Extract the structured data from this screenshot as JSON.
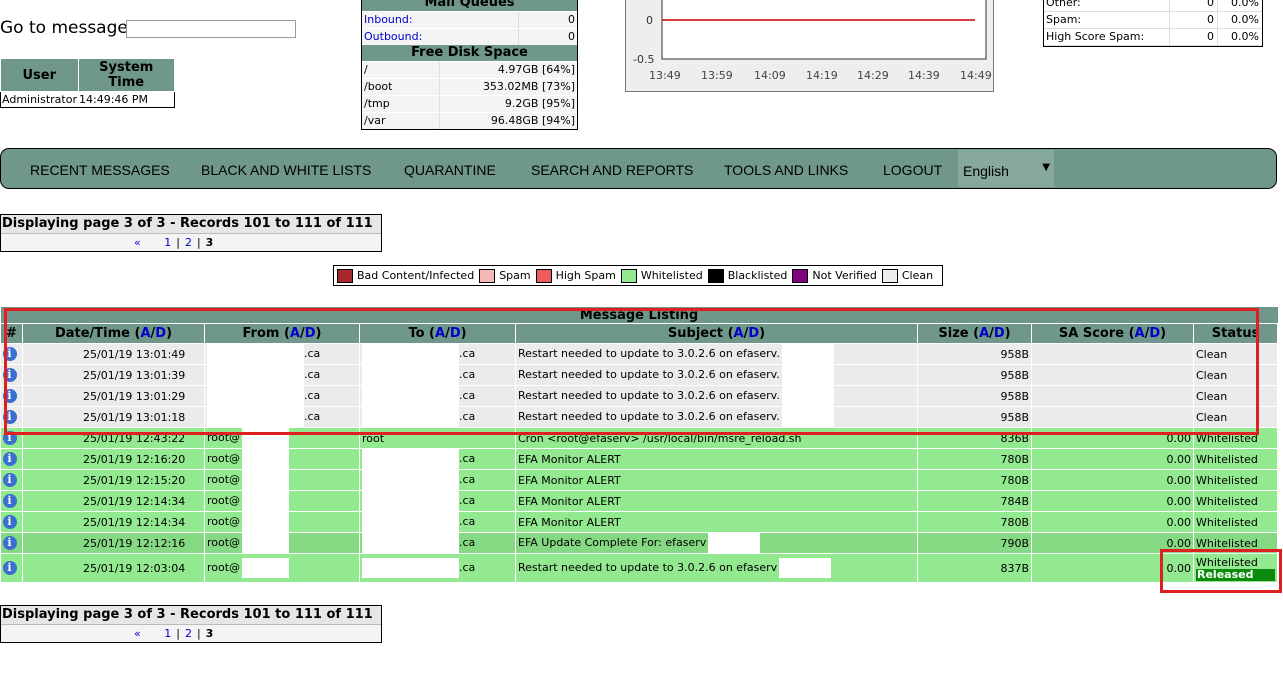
{
  "goto": {
    "label": "Go to message:",
    "placeholder": ""
  },
  "user_table": {
    "col_user": "User",
    "col_time": "System Time",
    "user": "Administrator",
    "time": "14:49:46 PM"
  },
  "queues": {
    "title": "Mail Queues",
    "inbound_label": "Inbound:",
    "inbound_value": "0",
    "outbound_label": "Outbound:",
    "outbound_value": "0"
  },
  "disk": {
    "title": "Free Disk Space",
    "rows": [
      {
        "mount": "/",
        "free": "4.97GB [64%]"
      },
      {
        "mount": "/boot",
        "free": "353.02MB [73%]"
      },
      {
        "mount": "/tmp",
        "free": "9.2GB [95%]"
      },
      {
        "mount": "/var",
        "free": "96.48GB [94%]"
      }
    ]
  },
  "graph": {
    "y_ticks": [
      "0",
      "-0.5"
    ],
    "x_ticks": [
      "13:49",
      "13:59",
      "14:09",
      "14:19",
      "14:29",
      "14:39",
      "14:49"
    ],
    "line_color": "#cc0000"
  },
  "stats": {
    "rows": [
      {
        "label": "Other:",
        "count": "0",
        "pct": "0.0%"
      },
      {
        "label": "Spam:",
        "count": "0",
        "pct": "0.0%"
      },
      {
        "label": "High Score Spam:",
        "count": "0",
        "pct": "0.0%"
      }
    ]
  },
  "nav": {
    "items": [
      "RECENT MESSAGES",
      "BLACK AND WHITE LISTS",
      "QUARANTINE",
      "SEARCH AND REPORTS",
      "TOOLS AND LINKS",
      "LOGOUT"
    ],
    "language": "English"
  },
  "pager": {
    "title": "Displaying page 3 of 3 - Records 101 to 111 of 111",
    "prev": "«",
    "page1": "1",
    "page2": "2",
    "current": "3",
    "sep": "|"
  },
  "legend": [
    {
      "label": "Bad Content/Infected",
      "color": "#a8282d"
    },
    {
      "label": "Spam",
      "color": "#f6b7b9"
    },
    {
      "label": "High Spam",
      "color": "#ee5b61"
    },
    {
      "label": "Whitelisted",
      "color": "#92e98f"
    },
    {
      "label": "Blacklisted",
      "color": "#000000"
    },
    {
      "label": "Not Verified",
      "color": "#800080"
    },
    {
      "label": "Clean",
      "color": "#eeeeee"
    }
  ],
  "table": {
    "caption": "Message Listing",
    "headers": {
      "num": "#",
      "date": "Date/Time",
      "from": "From",
      "to": "To",
      "subject": "Subject",
      "size": "Size",
      "score": "SA Score",
      "status": "Status",
      "asc": "A",
      "desc": "D",
      "slash": "/",
      "open": "(",
      "close": ")"
    },
    "rows": [
      {
        "kind": "clean",
        "date": "25/01/19 13:01:49",
        "from": ".ca",
        "to": ".ca",
        "subject": "Restart needed to update to 3.0.2.6 on efaserv.",
        "size": "958B",
        "score": "",
        "status": "Clean",
        "status2": ""
      },
      {
        "kind": "clean",
        "date": "25/01/19 13:01:39",
        "from": ".ca",
        "to": ".ca",
        "subject": "Restart needed to update to 3.0.2.6 on efaserv.",
        "size": "958B",
        "score": "",
        "status": "Clean",
        "status2": ""
      },
      {
        "kind": "clean",
        "date": "25/01/19 13:01:29",
        "from": ".ca",
        "to": ".ca",
        "subject": "Restart needed to update to 3.0.2.6 on efaserv.",
        "size": "958B",
        "score": "",
        "status": "Clean",
        "status2": ""
      },
      {
        "kind": "clean",
        "date": "25/01/19 13:01:18",
        "from": ".ca",
        "to": ".ca",
        "subject": "Restart needed to update to 3.0.2.6 on efaserv.",
        "size": "958B",
        "score": "",
        "status": "Clean",
        "status2": ""
      },
      {
        "kind": "white",
        "date": "25/01/19 12:43:22",
        "from": "root@",
        "to": "root",
        "subject": "Cron <root@efaserv> /usr/local/bin/msre_reload.sh",
        "size": "836B",
        "score": "0.00",
        "status": "Whitelisted",
        "status2": ""
      },
      {
        "kind": "white",
        "date": "25/01/19 12:16:20",
        "from": "root@",
        "to": ".ca",
        "subject": "EFA Monitor ALERT",
        "size": "780B",
        "score": "0.00",
        "status": "Whitelisted",
        "status2": ""
      },
      {
        "kind": "white",
        "date": "25/01/19 12:15:20",
        "from": "root@",
        "to": ".ca",
        "subject": "EFA Monitor ALERT",
        "size": "780B",
        "score": "0.00",
        "status": "Whitelisted",
        "status2": ""
      },
      {
        "kind": "white",
        "date": "25/01/19 12:14:34",
        "from": "root@",
        "to": ".ca",
        "subject": "EFA Monitor ALERT",
        "size": "784B",
        "score": "0.00",
        "status": "Whitelisted",
        "status2": ""
      },
      {
        "kind": "white",
        "date": "25/01/19 12:14:34",
        "from": "root@",
        "to": ".ca",
        "subject": "EFA Monitor ALERT",
        "size": "780B",
        "score": "0.00",
        "status": "Whitelisted",
        "status2": ""
      },
      {
        "kind": "white alt",
        "date": "25/01/19 12:12:16",
        "from": "root@",
        "to": ".ca",
        "subject": "EFA Update Complete For: efaserv",
        "size": "790B",
        "score": "0.00",
        "status": "Whitelisted",
        "status2": ""
      },
      {
        "kind": "white",
        "date": "25/01/19 12:03:04",
        "from": "root@",
        "to": ".ca",
        "subject": "Restart needed to update to 3.0.2.6 on efaserv",
        "size": "837B",
        "score": "0.00",
        "status": "Whitelisted",
        "status2": "Released"
      }
    ]
  }
}
